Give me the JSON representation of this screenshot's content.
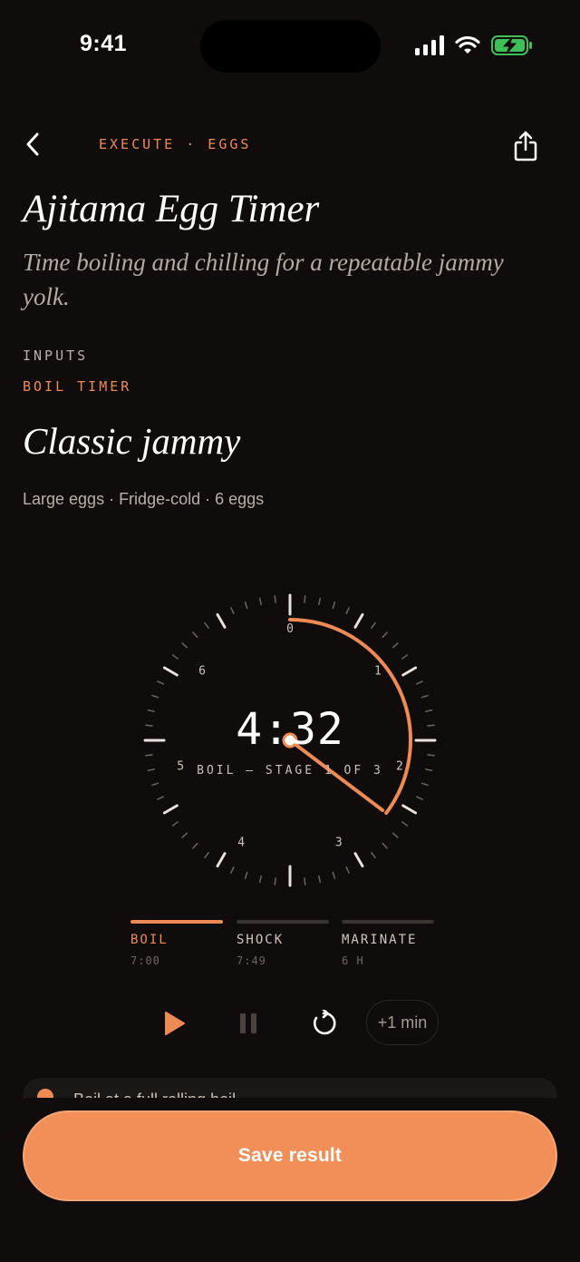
{
  "status_bar": {
    "time": "9:41"
  },
  "header": {
    "breadcrumb": "EXECUTE · EGGS"
  },
  "recipe": {
    "title": "Ajitama Egg Timer",
    "subtitle": "Time boiling and chilling for a repeatable jammy yolk."
  },
  "inputs": {
    "section_label": "INPUTS",
    "timer_label": "BOIL TIMER"
  },
  "preset": {
    "title": "Classic jammy",
    "meta": "Large eggs · Fridge-cold · 6 eggs"
  },
  "dial": {
    "readout": "4:32",
    "stage_text": "BOIL — STAGE 1 OF 3",
    "numbers": [
      "0",
      "1",
      "2",
      "3",
      "4",
      "5",
      "6"
    ],
    "max_minutes": 7,
    "elapsed_minutes": 2.47,
    "accent": "#ee8b55"
  },
  "stages": [
    {
      "name": "BOIL",
      "duration": "7:00",
      "active": true
    },
    {
      "name": "SHOCK",
      "duration": "7:49",
      "active": false
    },
    {
      "name": "MARINATE",
      "duration": "6 H",
      "active": false
    }
  ],
  "controls": {
    "play_icon": "play-icon",
    "pause_icon": "pause-icon",
    "reset_icon": "reset-icon",
    "add_minute_label": "+1 min"
  },
  "tip": {
    "text": "Boil at a full rolling boil"
  },
  "save_button": {
    "label": "Save result"
  },
  "colors": {
    "accent": "#ee8b55",
    "button": "#f28e58",
    "background": "#0f0c0b"
  }
}
